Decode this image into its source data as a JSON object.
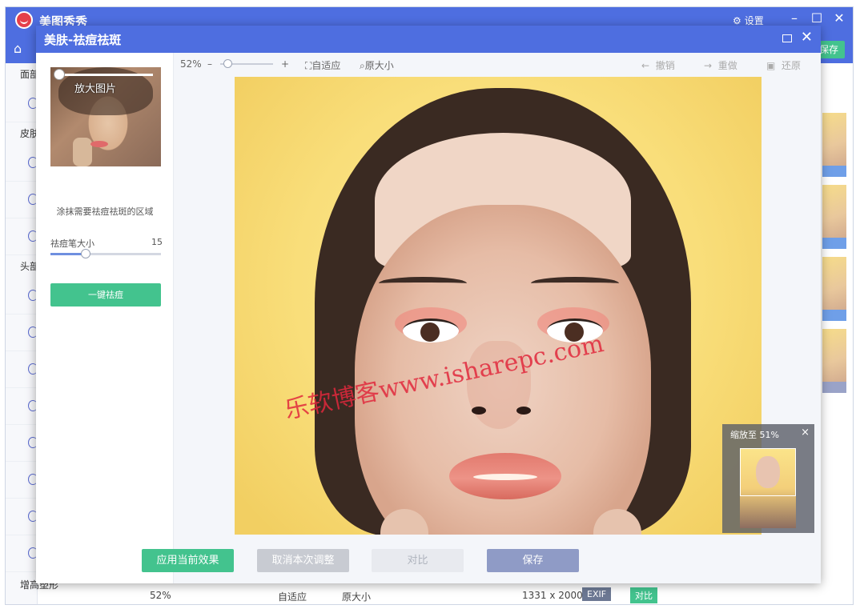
{
  "app": {
    "title": "美图秀秀",
    "settings_label": "设置",
    "save_label": "保存",
    "sidebar_sections": [
      "面部",
      "皮肤",
      "头部"
    ],
    "bottom_left_label": "增高塑形",
    "bottom_bar": {
      "zoom": "52%",
      "fit": "自适应",
      "original": "原大小",
      "dimensions": "1331 x 2000",
      "exif": "EXIF",
      "compare": "对比"
    }
  },
  "dialog": {
    "title": "美肤-祛痘祛斑",
    "preview_zoom_label": "放大图片",
    "hint": "涂抹需要祛痘祛斑的区域",
    "brush_label": "祛痘笔大小",
    "brush_value": "15",
    "brush_fraction": 0.32,
    "one_click_label": "一键祛痘",
    "toolbar": {
      "zoom_percent": "52%",
      "minus": "–",
      "plus": "+",
      "fit": "自适应",
      "original_size": "原大小",
      "undo": "撤销",
      "redo": "重做",
      "restore": "还原"
    },
    "watermark": "乐软博客www.isharepc.com",
    "navigator": {
      "label": "缩放至 51%",
      "close": "×"
    },
    "buttons": {
      "apply": "应用当前效果",
      "cancel": "取消本次调整",
      "compare": "对比",
      "save": "保存"
    }
  },
  "colors": {
    "titlebar": "#4e6ee0",
    "accent_green": "#43c38e",
    "save_button": "#8f9bc6"
  }
}
